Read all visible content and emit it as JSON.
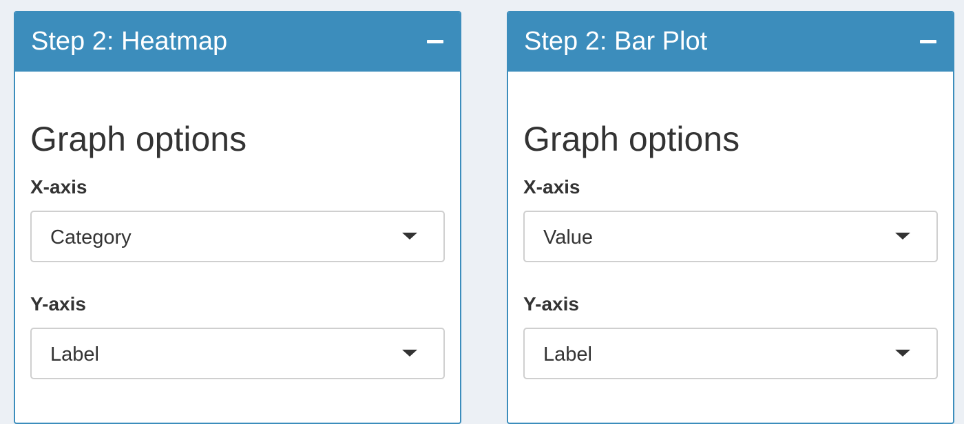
{
  "panels": [
    {
      "title": "Step 2: Heatmap",
      "section_title": "Graph options",
      "x_axis": {
        "label": "X-axis",
        "value": "Category"
      },
      "y_axis": {
        "label": "Y-axis",
        "value": "Label"
      }
    },
    {
      "title": "Step 2: Bar Plot",
      "section_title": "Graph options",
      "x_axis": {
        "label": "X-axis",
        "value": "Value"
      },
      "y_axis": {
        "label": "Y-axis",
        "value": "Label"
      }
    }
  ],
  "icons": {
    "collapse": "minus-icon",
    "dropdown": "caret-down-icon"
  },
  "colors": {
    "header": "#3c8dbc",
    "background": "#ecf0f5",
    "text": "#333333"
  }
}
